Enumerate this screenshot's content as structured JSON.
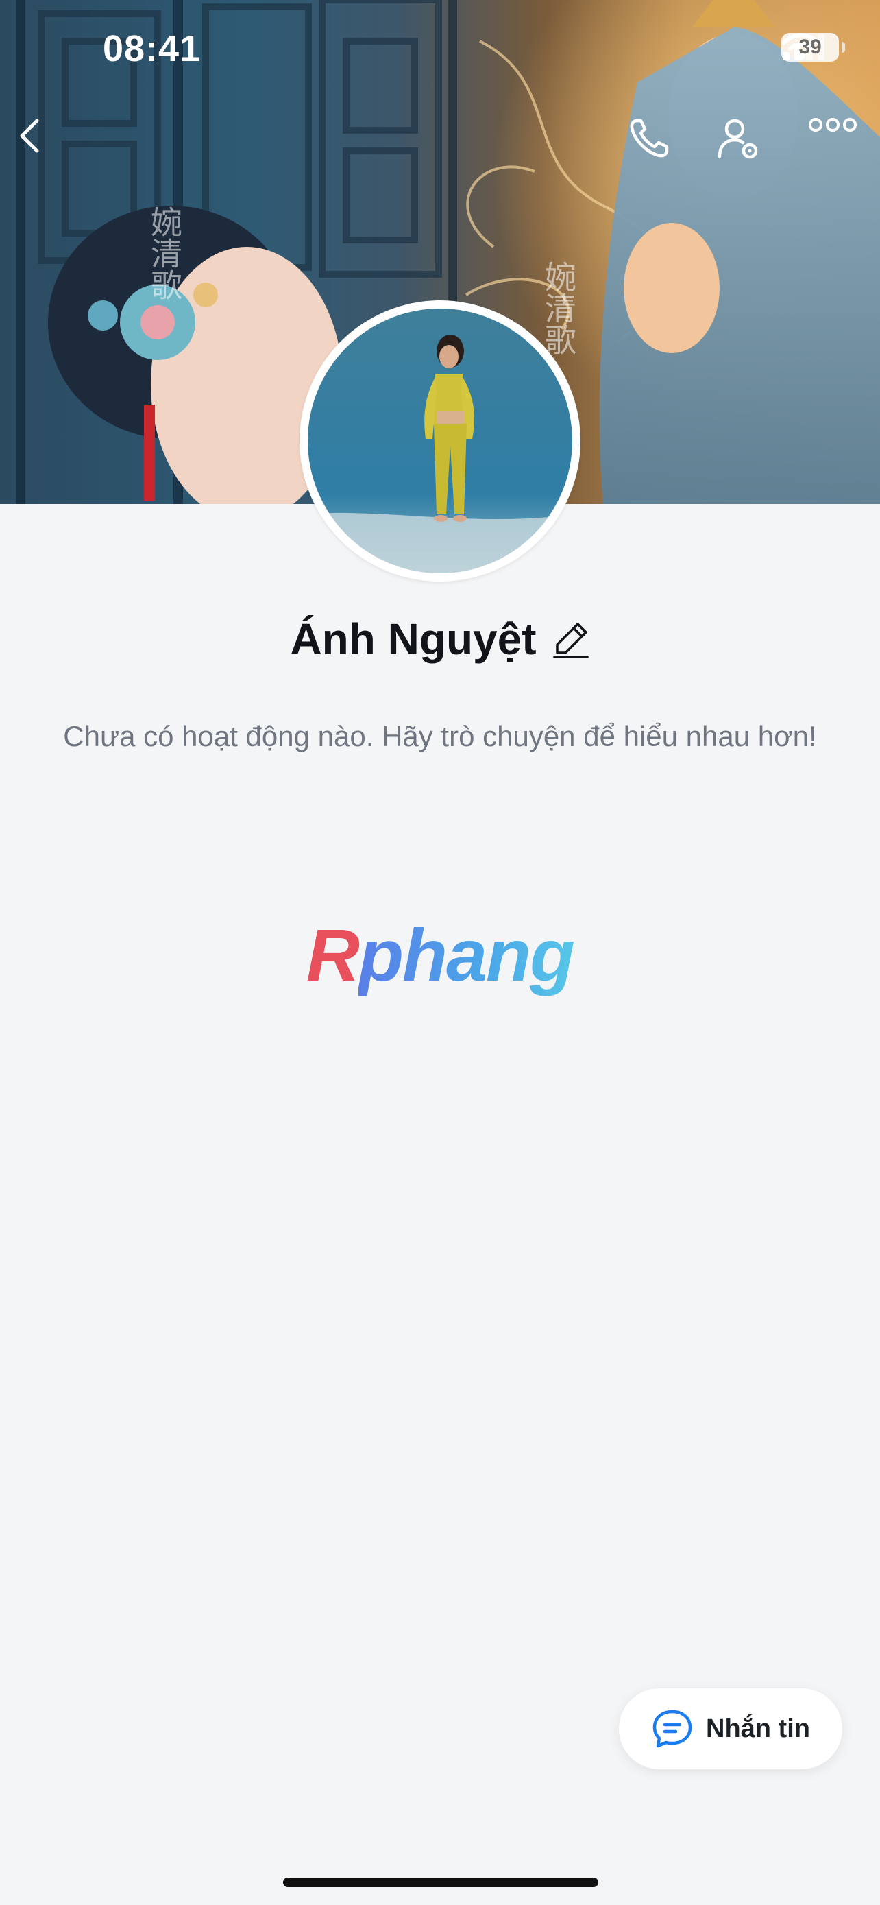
{
  "status_bar": {
    "time": "08:41",
    "battery": "39"
  },
  "cover": {
    "calligraphy": "婉清歌"
  },
  "header": {
    "back_icon": "chevron-left-icon",
    "call_icon": "phone-icon",
    "profile_settings_icon": "user-settings-icon",
    "more_icon": "more-dots-icon"
  },
  "profile": {
    "name": "Ánh Nguyệt",
    "edit_icon": "pencil-icon",
    "empty_message": "Chưa có hoạt động nào. Hãy trò chuyện để hiểu nhau hơn!"
  },
  "watermark": {
    "first": "R",
    "rest": "phang"
  },
  "message_button": {
    "label": "Nhắn tin",
    "icon": "chat-bubble-icon"
  },
  "colors": {
    "background": "#f4f5f7",
    "accent": "#1a7cf0",
    "text_primary": "#111418",
    "text_secondary": "#6f7680"
  }
}
